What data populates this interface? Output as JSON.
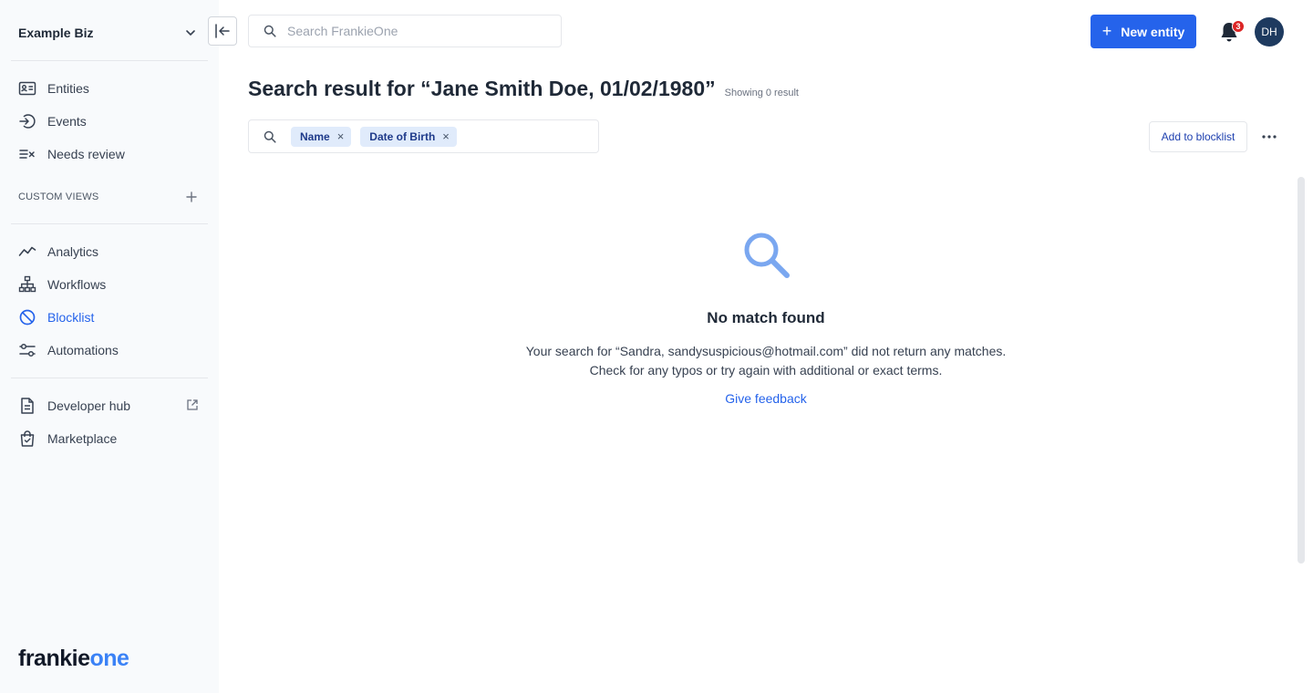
{
  "org": {
    "name": "Example Biz"
  },
  "sidebar": {
    "primary": [
      {
        "label": "Entities",
        "icon": "id-card-icon"
      },
      {
        "label": "Events",
        "icon": "sign-in-icon"
      },
      {
        "label": "Needs review",
        "icon": "review-list-icon"
      }
    ],
    "custom_views_label": "CUSTOM VIEWS",
    "secondary": [
      {
        "label": "Analytics",
        "icon": "trend-line-icon"
      },
      {
        "label": "Workflows",
        "icon": "hierarchy-icon"
      },
      {
        "label": "Blocklist",
        "icon": "block-icon",
        "active": true
      },
      {
        "label": "Automations",
        "icon": "sliders-icon"
      }
    ],
    "tertiary": [
      {
        "label": "Developer hub",
        "icon": "document-icon",
        "external": true
      },
      {
        "label": "Marketplace",
        "icon": "shopping-bag-icon"
      }
    ],
    "logo": {
      "part1": "frankie",
      "part2": "one"
    }
  },
  "header": {
    "search_placeholder": "Search FrankieOne",
    "new_entity_label": "New entity",
    "notification_count": "3",
    "avatar_initials": "DH"
  },
  "main": {
    "title": "Search result for “Jane Smith Doe, 01/02/1980”",
    "result_count": "Showing 0 result",
    "filters": [
      {
        "label": "Name"
      },
      {
        "label": "Date of Birth"
      }
    ],
    "add_to_blocklist_label": "Add to blocklist",
    "empty_state": {
      "title": "No match found",
      "line1": "Your search for “Sandra, sandysuspicious@hotmail.com” did not return any matches.",
      "line2": "Check for any typos or try again with additional or exact terms.",
      "feedback_label": "Give feedback"
    }
  },
  "colors": {
    "accent": "#2563eb",
    "sidebar_bg": "#f8fafc",
    "chip_bg": "#e0ebfb",
    "badge": "#dc2626",
    "empty_icon": "#7aa7f0"
  }
}
